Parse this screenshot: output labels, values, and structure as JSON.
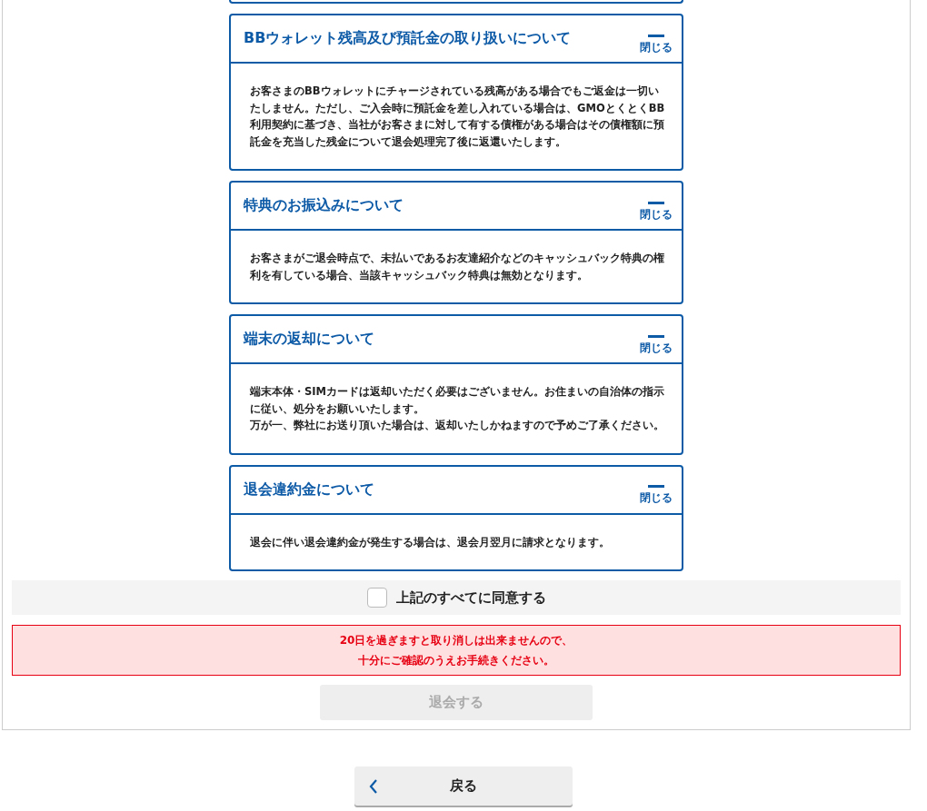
{
  "sections": [
    {
      "title": "BBウォレット残高及び預託金の取り扱いについて",
      "toggle_label": "閉じる",
      "expanded": true,
      "body": "お客さまのBBウォレットにチャージされている残高がある場合でもご返金は一切いたしません。ただし、ご入会時に預託金を差し入れている場合は、GMOとくとくBB利用契約に基づき、当社がお客さまに対して有する債権がある場合はその債権額に預託金を充当した残金について退会処理完了後に返還いたします。"
    },
    {
      "title": "特典のお振込みについて",
      "toggle_label": "閉じる",
      "expanded": true,
      "body": "お客さまがご退会時点で、未払いであるお友達紹介などのキャッシュバック特典の権利を有している場合、当該キャッシュバック特典は無効となります。"
    },
    {
      "title": "端末の返却について",
      "toggle_label": "閉じる",
      "expanded": true,
      "body": "端末本体・SIMカードは返却いただく必要はございません。お住まいの自治体の指示に従い、処分をお願いいたします。",
      "note": "万が一、弊社にお送り頂いた場合は、返却いたしかねますので予めご了承ください。"
    },
    {
      "title": "退会違約金について",
      "toggle_label": "閉じる",
      "expanded": true,
      "body": "退会に伴い退会違約金が発生する場合は、退会月翌月に請求となります。"
    }
  ],
  "agree": {
    "label": "上記のすべてに同意する",
    "checked": false
  },
  "warning": [
    "20日を過ぎますと取り消しは出来ませんので、",
    "十分にご確認のうえお手続きください。"
  ],
  "submit": {
    "label": "退会する",
    "disabled": true
  },
  "back": {
    "label": "戻る"
  }
}
